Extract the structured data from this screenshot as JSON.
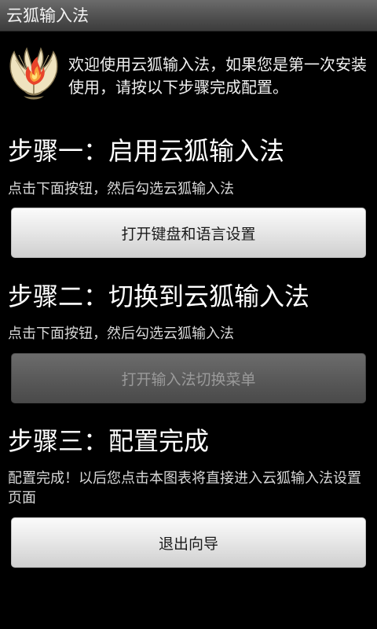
{
  "app": {
    "title": "云狐输入法"
  },
  "welcome": {
    "text": "欢迎使用云狐输入法，如果您是第一次安装使用，请按以下步骤完成配置。"
  },
  "steps": [
    {
      "title": "步骤一：启用云狐输入法",
      "description": "点击下面按钮，然后勾选云狐输入法",
      "button_label": "打开键盘和语言设置",
      "button_enabled": true
    },
    {
      "title": "步骤二：切换到云狐输入法",
      "description": "点击下面按钮，然后勾选云狐输入法",
      "button_label": "打开输入法切换菜单",
      "button_enabled": false
    },
    {
      "title": "步骤三：配置完成",
      "description": "配置完成！以后您点击本图表将直接进入云狐输入法设置页面",
      "button_label": "退出向导",
      "button_enabled": true
    }
  ],
  "icons": {
    "logo": "fox-flame-logo-icon"
  },
  "colors": {
    "background": "#000000",
    "titlebar": "#505050",
    "button_enabled": "#e6e6e6",
    "button_disabled": "#5a5a5a",
    "button_disabled_text": "#9a9a9a"
  }
}
